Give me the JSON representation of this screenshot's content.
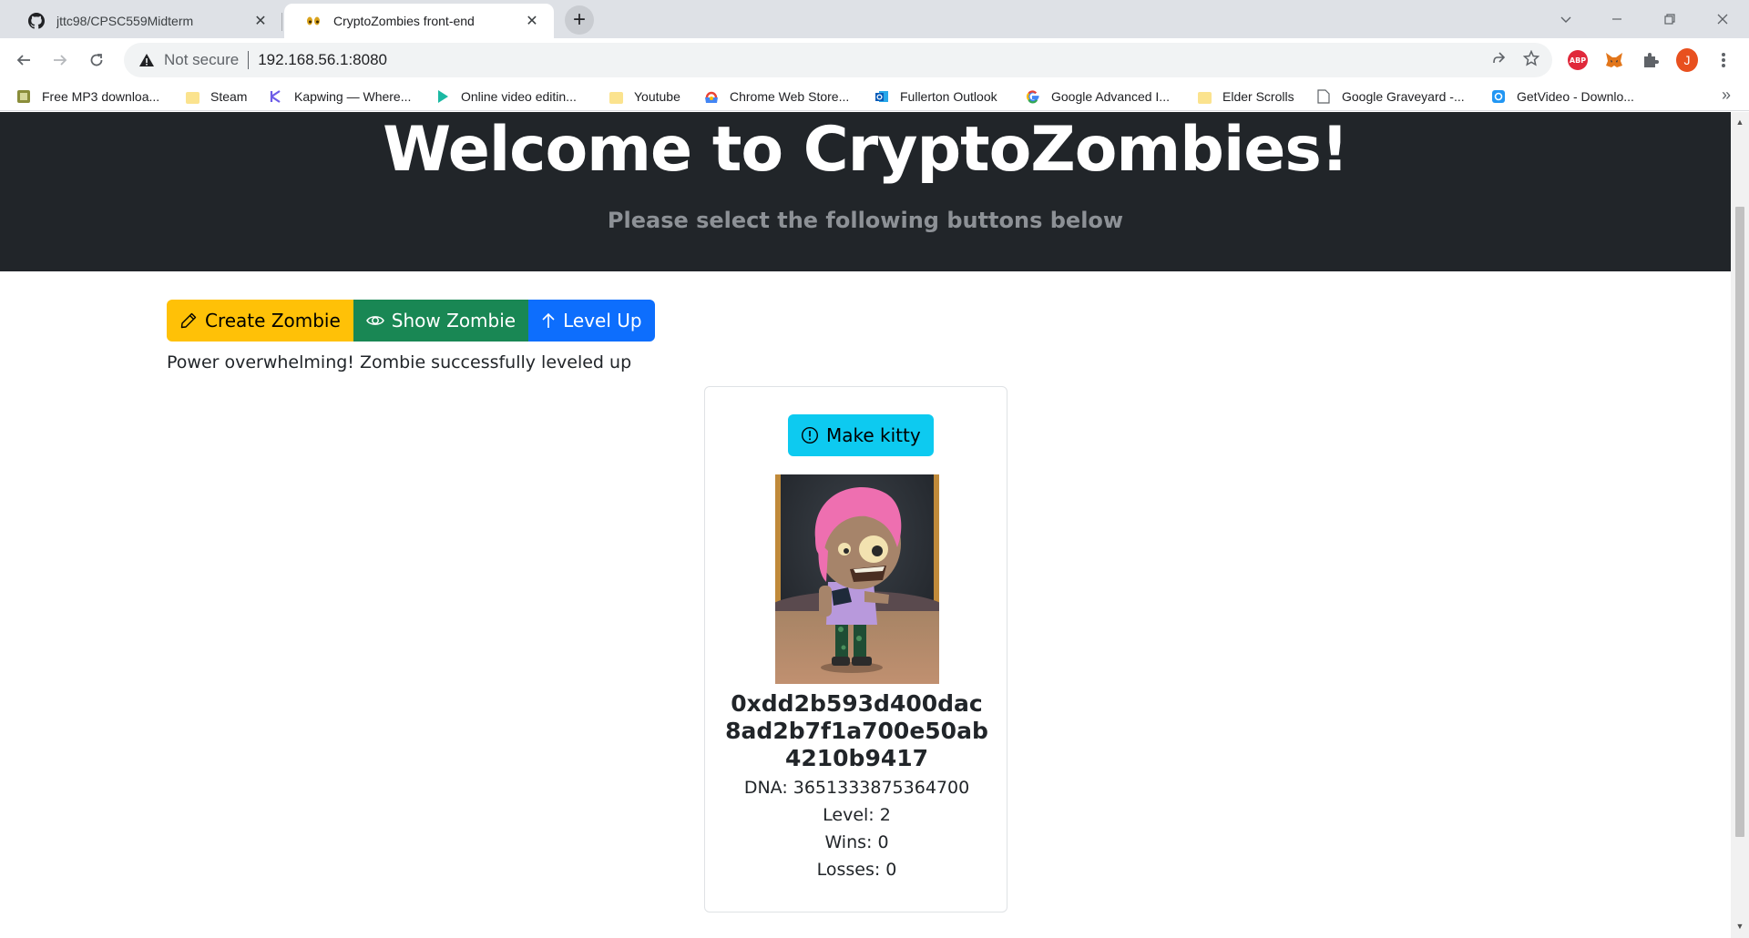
{
  "browser": {
    "tabs": [
      {
        "title": "jttc98/CPSC559Midterm",
        "icon": "github-icon"
      },
      {
        "title": "CryptoZombies front-end",
        "icon": "zombie-eyes-icon"
      }
    ],
    "address": {
      "security_label": "Not secure",
      "url": "192.168.56.1:8080"
    },
    "profile_initial": "J",
    "abp_label": "ABP",
    "bookmarks": [
      {
        "label": "Free MP3 downloa...",
        "icon": "mp3-icon"
      },
      {
        "label": "Steam",
        "icon": "folder-icon"
      },
      {
        "label": "Kapwing — Where...",
        "icon": "kapwing-icon"
      },
      {
        "label": "Online video editin...",
        "icon": "play-icon"
      },
      {
        "label": "Youtube",
        "icon": "folder-icon"
      },
      {
        "label": "Chrome Web Store...",
        "icon": "webstore-icon"
      },
      {
        "label": "Fullerton Outlook",
        "icon": "outlook-icon"
      },
      {
        "label": "Google Advanced I...",
        "icon": "google-icon"
      },
      {
        "label": "Elder Scrolls",
        "icon": "folder-icon"
      },
      {
        "label": "Google Graveyard -...",
        "icon": "page-icon"
      },
      {
        "label": "GetVideo - Downlo...",
        "icon": "getvideo-icon"
      }
    ]
  },
  "page": {
    "hero": {
      "title": "Welcome to CryptoZombies!",
      "subtitle": "Please select the following buttons below"
    },
    "actions": {
      "create_label": "Create Zombie",
      "show_label": "Show Zombie",
      "levelup_label": "Level Up"
    },
    "status_message": "Power overwhelming! Zombie successfully leveled up",
    "zombie_card": {
      "make_kitty_label": "Make kitty",
      "name": "0xdd2b593d400dac8ad2b7f1a700e50ab4210b9417",
      "dna": "DNA: 3651333875364700",
      "level": "Level: 2",
      "wins": "Wins: 0",
      "losses": "Losses: 0"
    }
  },
  "colors": {
    "hero_bg": "#212529",
    "warning": "#ffc107",
    "success": "#198754",
    "primary": "#0d6efd",
    "info": "#0dcaf0"
  }
}
